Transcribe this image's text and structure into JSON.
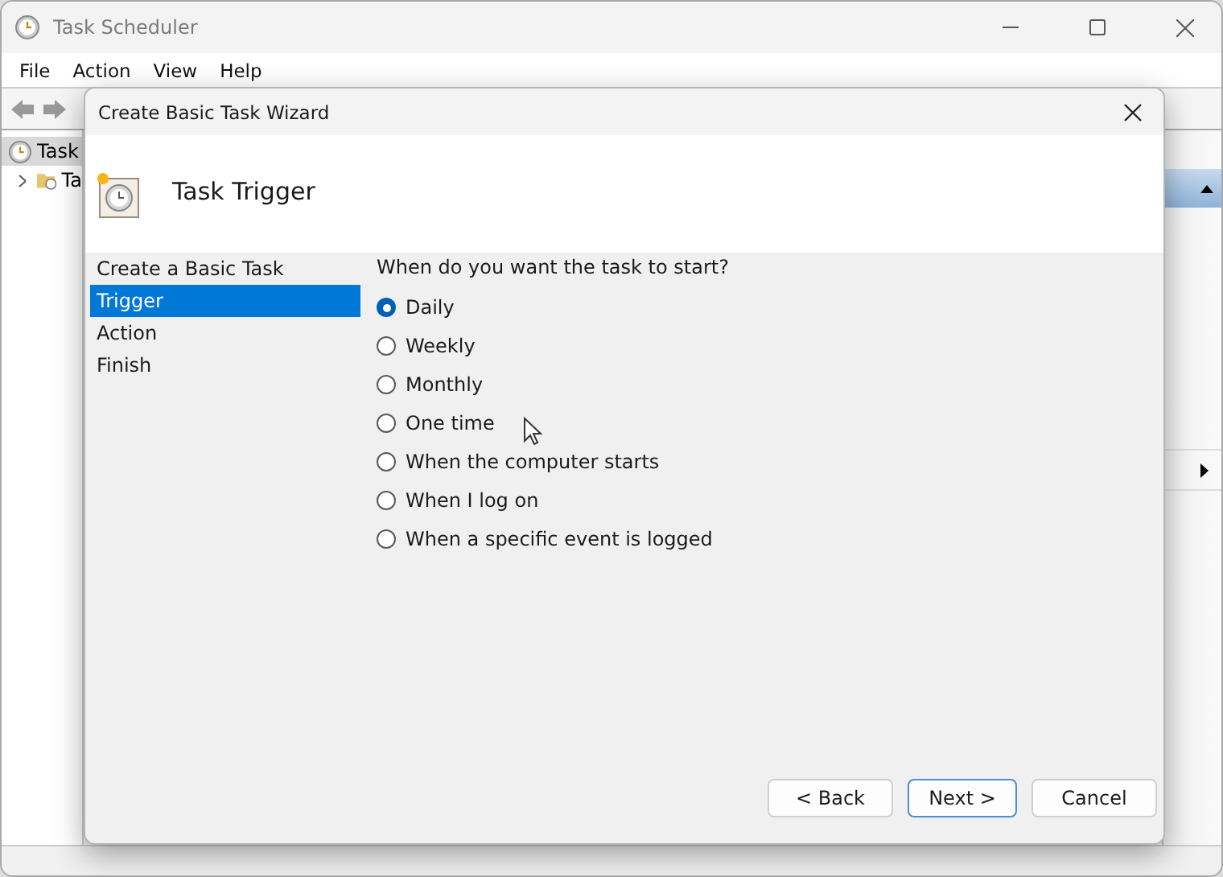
{
  "window": {
    "title": "Task Scheduler"
  },
  "menu": [
    "File",
    "Action",
    "View",
    "Help"
  ],
  "tree": [
    {
      "label": "Task",
      "selected": true,
      "has_children": false
    },
    {
      "label": "Ta",
      "selected": false,
      "has_children": true
    }
  ],
  "dialog": {
    "title": "Create Basic Task Wizard",
    "heading": "Task Trigger",
    "steps": [
      {
        "label": "Create a Basic Task",
        "selected": false
      },
      {
        "label": "Trigger",
        "selected": true
      },
      {
        "label": "Action",
        "selected": false
      },
      {
        "label": "Finish",
        "selected": false
      }
    ],
    "question": "When do you want the task to start?",
    "options": [
      {
        "label": "Daily",
        "selected": true
      },
      {
        "label": "Weekly",
        "selected": false
      },
      {
        "label": "Monthly",
        "selected": false
      },
      {
        "label": "One time",
        "selected": false
      },
      {
        "label": "When the computer starts",
        "selected": false
      },
      {
        "label": "When I log on",
        "selected": false
      },
      {
        "label": "When a specific event is logged",
        "selected": false
      }
    ],
    "buttons": [
      {
        "label": "< Back",
        "default": false
      },
      {
        "label": "Next >",
        "default": true
      },
      {
        "label": "Cancel",
        "default": false
      }
    ]
  }
}
